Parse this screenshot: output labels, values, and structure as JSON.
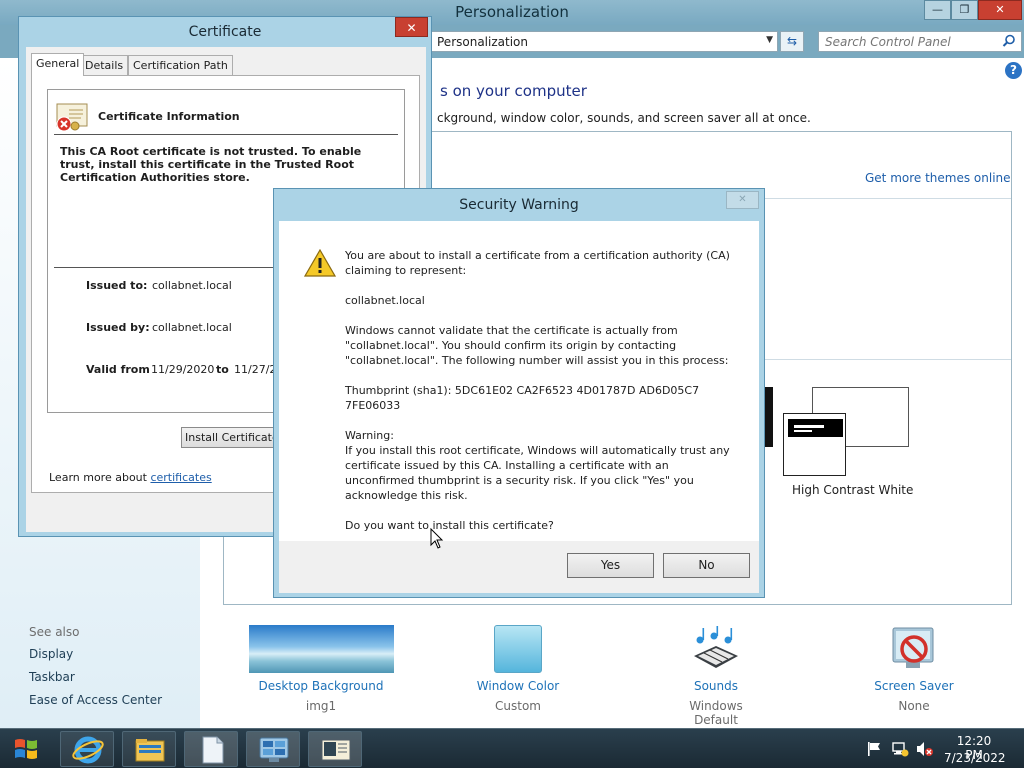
{
  "personalization": {
    "title": "Personalization",
    "caption": {
      "minimize": "—",
      "maximize": "❐",
      "close": "✕"
    },
    "address": "Personalization",
    "search_placeholder": "Search Control Panel",
    "heading": "s on your computer",
    "subheading": "ckground, window color, sounds, and screen saver all at once.",
    "get_more_themes": "Get more themes online",
    "high_contrast_label": "High Contrast White",
    "see_also": {
      "title": "See also",
      "links": [
        "Display",
        "Taskbar",
        "Ease of Access Center"
      ]
    },
    "bottom_items": [
      {
        "label": "Desktop Background",
        "sub": "img1"
      },
      {
        "label": "Window Color",
        "sub": "Custom"
      },
      {
        "label": "Sounds",
        "sub": "Windows Default"
      },
      {
        "label": "Screen Saver",
        "sub": "None"
      }
    ]
  },
  "certificate": {
    "title": "Certificate",
    "close": "✕",
    "tabs": [
      "General",
      "Details",
      "Certification Path"
    ],
    "info_title": "Certificate Information",
    "warning": "This CA Root certificate is not trusted. To enable trust, install this certificate in the Trusted Root Certification Authorities store.",
    "issued_to_label": "Issued to:",
    "issued_to": "collabnet.local",
    "issued_by_label": "Issued by:",
    "issued_by": "collabnet.local",
    "valid_from_label": "Valid from",
    "valid_from": "11/29/2020",
    "to_label": "to",
    "valid_to": "11/27/2",
    "install_button": "Install Certificate...",
    "learn_more_prefix": "Learn more about ",
    "learn_more_link": "certificates"
  },
  "security_warning": {
    "title": "Security Warning",
    "close": "✕",
    "paragraphs": [
      "You are about to install a certificate from a certification authority (CA) claiming to represent:",
      "collabnet.local",
      "Windows cannot validate that the certificate is actually from \"collabnet.local\". You should confirm its origin by contacting \"collabnet.local\". The following number will assist you in this process:",
      "Thumbprint (sha1): 5DC61E02 CA2F6523 4D01787D AD6D05C7 7FE06033",
      "Warning:\nIf you install this root certificate, Windows will automatically trust any certificate issued by this CA. Installing a certificate with an unconfirmed thumbprint is a security risk. If you click \"Yes\" you acknowledge this risk.",
      "Do you want to install this certificate?"
    ],
    "yes_button": "Yes",
    "no_button": "No"
  },
  "taskbar": {
    "time": "12:20 PM",
    "date": "7/23/2022"
  }
}
